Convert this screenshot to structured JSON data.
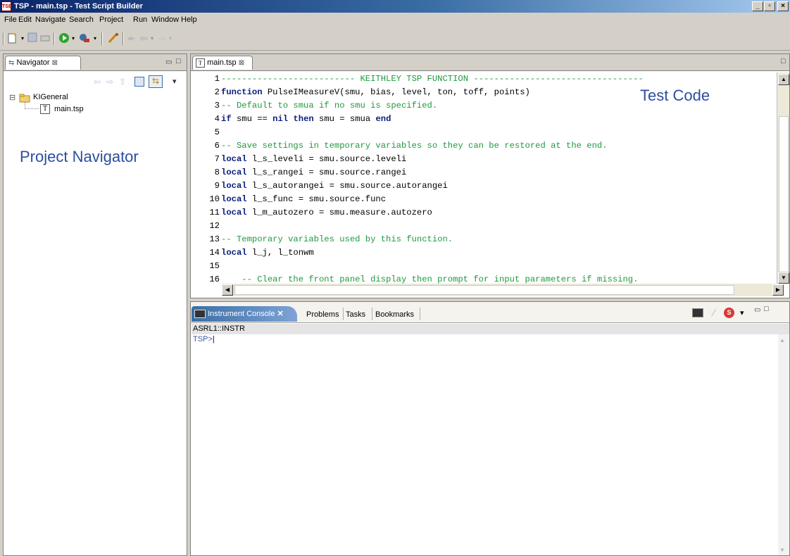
{
  "window": {
    "app_icon": "TSB",
    "title": "TSP - main.tsp - Test Script Builder",
    "minimize": "_",
    "maximize": "▫",
    "close": "×"
  },
  "menu": [
    "File",
    "Edit",
    "Navigate",
    "Search",
    "Project",
    "Run",
    "Window",
    "Help"
  ],
  "navigator": {
    "tab_label": "Navigator",
    "tab_close": "⊠",
    "view_menu": "▾",
    "project": {
      "expander": "⊟",
      "name": "KIGeneral",
      "file": "main.tsp"
    },
    "overlay_label": "Project Navigator"
  },
  "editor": {
    "tab_label": "main.tsp",
    "tab_close": "⊠",
    "overlay_label": "Test Code",
    "lines": [
      {
        "n": "1",
        "parts": [
          {
            "t": "-------------------------- KEITHLEY TSP FUNCTION ---------------------------------",
            "c": "cm"
          }
        ]
      },
      {
        "n": "2",
        "parts": [
          {
            "t": "function",
            "c": "kw"
          },
          {
            "t": " PulseIMeasureV(smu, bias, level, ton, toff, points)",
            "c": "nm"
          }
        ]
      },
      {
        "n": "3",
        "parts": [
          {
            "t": "-- Default to smua if no smu is specified.",
            "c": "cm"
          }
        ]
      },
      {
        "n": "4",
        "parts": [
          {
            "t": "if",
            "c": "kw"
          },
          {
            "t": " smu == ",
            "c": "nm"
          },
          {
            "t": "nil",
            "c": "kw"
          },
          {
            "t": " ",
            "c": "nm"
          },
          {
            "t": "then",
            "c": "kw"
          },
          {
            "t": " smu = smua ",
            "c": "nm"
          },
          {
            "t": "end",
            "c": "kw"
          }
        ]
      },
      {
        "n": "5",
        "parts": []
      },
      {
        "n": "6",
        "parts": [
          {
            "t": "-- Save settings in temporary variables so they can be restored at the end.",
            "c": "cm"
          }
        ]
      },
      {
        "n": "7",
        "parts": [
          {
            "t": "local",
            "c": "kw"
          },
          {
            "t": " l_s_leveli = smu.source.leveli",
            "c": "nm"
          }
        ]
      },
      {
        "n": "8",
        "parts": [
          {
            "t": "local",
            "c": "kw"
          },
          {
            "t": " l_s_rangei = smu.source.rangei",
            "c": "nm"
          }
        ]
      },
      {
        "n": "9",
        "parts": [
          {
            "t": "local",
            "c": "kw"
          },
          {
            "t": " l_s_autorangei = smu.source.autorangei",
            "c": "nm"
          }
        ]
      },
      {
        "n": "10",
        "parts": [
          {
            "t": "local",
            "c": "kw"
          },
          {
            "t": " l_s_func = smu.source.func",
            "c": "nm"
          }
        ]
      },
      {
        "n": "11",
        "parts": [
          {
            "t": "local",
            "c": "kw"
          },
          {
            "t": " l_m_autozero = smu.measure.autozero",
            "c": "nm"
          }
        ]
      },
      {
        "n": "12",
        "parts": []
      },
      {
        "n": "13",
        "parts": [
          {
            "t": "-- Temporary variables used by this function.",
            "c": "cm"
          }
        ]
      },
      {
        "n": "14",
        "parts": [
          {
            "t": "local",
            "c": "kw"
          },
          {
            "t": " l_j, l_tonwm",
            "c": "nm"
          }
        ]
      },
      {
        "n": "15",
        "parts": []
      },
      {
        "n": "16",
        "parts": [
          {
            "t": "    -- Clear the front panel display then prompt for input parameters if missing.",
            "c": "cm"
          }
        ]
      }
    ]
  },
  "console": {
    "tabs": [
      {
        "label": "Instrument Console",
        "close": "✕",
        "active": true
      },
      {
        "label": "Problems",
        "active": false
      },
      {
        "label": "Tasks",
        "active": false
      },
      {
        "label": "Bookmarks",
        "active": false
      }
    ],
    "resource": "ASRL1::INSTR",
    "prompt": "TSP>",
    "stop_badge": "S",
    "view_menu": "▾"
  },
  "icons": [
    "app-icon",
    "new-icon",
    "save-icon",
    "print-icon",
    "run-icon",
    "debug-icon",
    "tool-icon",
    "back-icon",
    "forward-icon",
    "collapse-all-icon",
    "link-editor-icon",
    "folder-icon",
    "file-icon",
    "console-icon",
    "terminal-icon",
    "clear-icon",
    "stop-icon",
    "minimize-icon",
    "maximize-icon"
  ]
}
